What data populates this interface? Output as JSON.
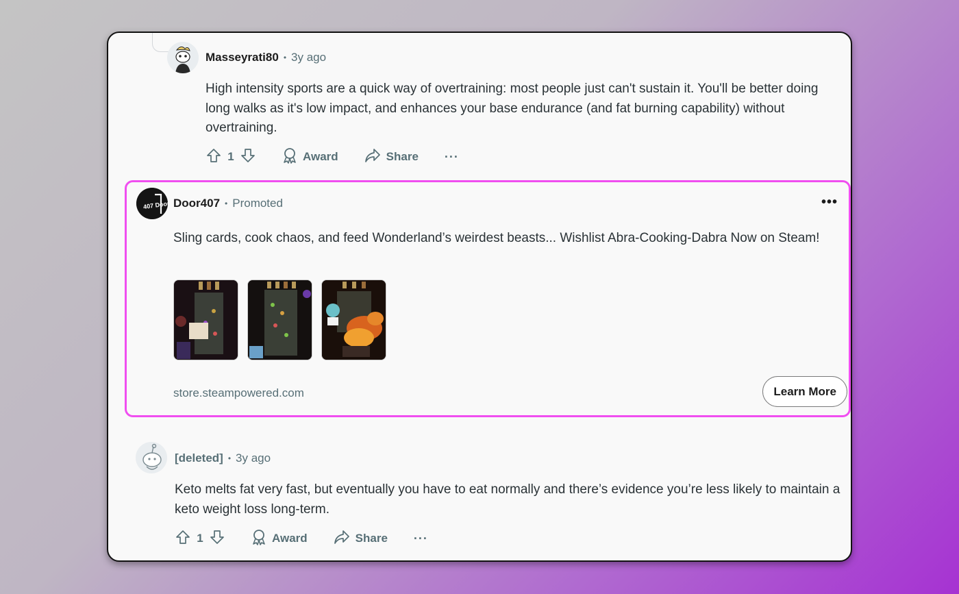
{
  "comment1": {
    "author": "Masseyrati80",
    "time": "3y ago",
    "text": "High intensity sports are a quick way of overtraining: most people just can't sustain it. You'll be better doing long walks as it's low impact, and enhances your base endurance (and fat burning capability) without overtraining.",
    "votes": "1",
    "award_label": "Award",
    "share_label": "Share",
    "more_label": "···"
  },
  "ad": {
    "author": "Door407",
    "promoted_label": "Promoted",
    "avatar_text": "407 Door",
    "text": "Sling cards, cook chaos, and feed Wonderland’s weirdest beasts... Wishlist Abra-Cooking-Dabra Now on Steam!",
    "thumbnails": [
      "game-screenshot-1",
      "game-screenshot-2",
      "game-screenshot-3"
    ],
    "domain": "store.steampowered.com",
    "cta_label": "Learn More",
    "more_label": "•••",
    "highlight_color": "#f04ef0"
  },
  "comment2": {
    "author": "[deleted]",
    "time": "3y ago",
    "text": "Keto melts fat very fast, but eventually you have to eat normally and there’s evidence you’re less likely to maintain a keto weight loss long-term.",
    "votes": "1",
    "award_label": "Award",
    "share_label": "Share",
    "more_label": "···"
  },
  "separator": "•",
  "icons": [
    "upvote-icon",
    "downvote-icon",
    "award-icon",
    "share-icon"
  ]
}
